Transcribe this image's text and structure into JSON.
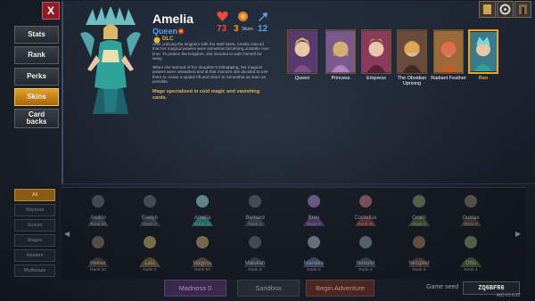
{
  "close_label": "X",
  "menu": [
    {
      "label": "Stats",
      "active": false
    },
    {
      "label": "Rank",
      "active": false
    },
    {
      "label": "Perks",
      "active": false
    },
    {
      "label": "Skins",
      "active": true
    }
  ],
  "menu_cardbacks": {
    "line1": "Card",
    "line2": "backs"
  },
  "hero": {
    "name": "Amelia",
    "class": "Queen",
    "dlc": "DLC",
    "lore1": "After unifying the kingdom with the Wolf Wars, Amelia noticed that her magical powers were somehow becoming unstable over time. To protect the kingdom, she decided to exile herself far away.",
    "lore2": "When she learned of her daughter's kidnapping, her magical powers were unleashed and at that moment she decided to use them to create a spatial rift and return to Senenthia as soon as possible.",
    "tagline": "Mage specialized in cold magic and vanishing cards.",
    "hp": "73",
    "energy": "3",
    "energy_sub": "3/turn",
    "speed": "12"
  },
  "skins": [
    {
      "label": "Queen",
      "selected": false,
      "color": "#5a3a6a"
    },
    {
      "label": "Princess",
      "selected": false,
      "color": "#7a5a8a"
    },
    {
      "label": "Empress",
      "selected": false,
      "color": "#8a3a5a"
    },
    {
      "label": "The Obsidian Uprising",
      "selected": false,
      "color": "#6a4a3a"
    },
    {
      "label": "Radiant Feather",
      "selected": false,
      "color": "#9a6a3a"
    },
    {
      "label": "Ran",
      "selected": true,
      "color": "#3a7a8a"
    }
  ],
  "filters": [
    {
      "label": "All",
      "active": true
    },
    {
      "label": "Warriors",
      "active": false
    },
    {
      "label": "Scouts",
      "active": false
    },
    {
      "label": "Mages",
      "active": false
    },
    {
      "label": "Healers",
      "active": false
    },
    {
      "label": "Multiclass",
      "active": false
    }
  ],
  "roster_row1": [
    {
      "name": "Andrin",
      "rank": "Rank 50"
    },
    {
      "name": "Evelyn",
      "rank": "Rank 0"
    },
    {
      "name": "Amelia",
      "rank": "Rank 15"
    },
    {
      "name": "Bernard",
      "rank": "Rank 0"
    },
    {
      "name": "Bree",
      "rank": "Rank 0"
    },
    {
      "name": "Cornelius",
      "rank": "Rank 45"
    },
    {
      "name": "Grukli",
      "rank": "Rank 0"
    },
    {
      "name": "Gustav",
      "rank": "Rank 0"
    }
  ],
  "roster_row2": [
    {
      "name": "Heiner",
      "rank": "Rank 10"
    },
    {
      "name": "Laia",
      "rank": "Rank 0"
    },
    {
      "name": "Magnus",
      "rank": "Rank 50"
    },
    {
      "name": "Malukah",
      "rank": "Rank 0"
    },
    {
      "name": "Navalea",
      "rank": "Rank 0"
    },
    {
      "name": "Nenukil",
      "rank": "Rank 4"
    },
    {
      "name": "Nezglekt",
      "rank": "Rank 5"
    },
    {
      "name": "Ottis",
      "rank": "Rank 4"
    }
  ],
  "footer": {
    "madness": "Madness 0",
    "sandbox": "Sandbox",
    "adventure": "Begin Adventure",
    "seed_label": "Game seed",
    "seed_value": "ZQ6BFR6",
    "version": "AtO #1.6.22"
  },
  "colors": {
    "accent": "#f0a418",
    "class_blue": "#5a9ee8",
    "hp_red": "#e74c3c"
  },
  "icons": {
    "hp": "heart-icon",
    "energy": "energy-orb-icon",
    "speed": "speed-icon"
  }
}
